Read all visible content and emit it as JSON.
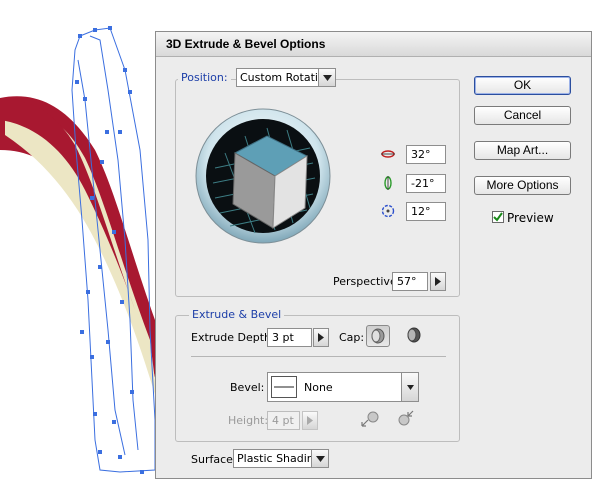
{
  "dialog": {
    "title": "3D Extrude & Bevel Options",
    "position_label": "Position:",
    "position_value": "Custom Rotation",
    "rotation": {
      "x_value": "32°",
      "y_value": "-21°",
      "z_value": "12°",
      "x_icon": "rotate-x-axis-icon",
      "y_icon": "rotate-y-axis-icon",
      "z_icon": "rotate-z-axis-icon"
    },
    "perspective_label": "Perspective:",
    "perspective_value": "57°",
    "extrude_section_label": "Extrude & Bevel",
    "extrude_depth_label": "Extrude Depth:",
    "extrude_depth_value": "3 pt",
    "cap_label": "Cap:",
    "bevel_label": "Bevel:",
    "bevel_value": "None",
    "height_label": "Height:",
    "height_value": "4 pt",
    "surface_label": "Surface:",
    "surface_value": "Plastic Shading",
    "buttons": {
      "ok": "OK",
      "cancel": "Cancel",
      "map_art": "Map Art...",
      "more_options": "More Options"
    },
    "preview_label": "Preview",
    "preview_checked": true
  },
  "colors": {
    "accent_blue": "#1c3ea8",
    "cube_top": "#5e9fb6",
    "ribbon_red": "#a81830",
    "ribbon_cream": "#ece6c4",
    "selection_blue": "#3b6fe0"
  }
}
